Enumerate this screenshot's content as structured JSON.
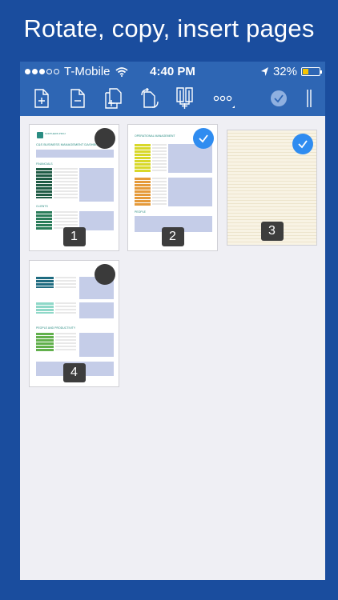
{
  "headline": "Rotate, copy, insert pages",
  "status_bar": {
    "carrier": "T-Mobile",
    "time": "4:40 PM",
    "battery": "32%",
    "signal_bars_filled": 3,
    "signal_bars_total": 5,
    "battery_level": 0.32
  },
  "toolbar": {
    "icons": [
      "insert-page-icon",
      "delete-page-icon",
      "copy-page-icon",
      "rotate-page-icon",
      "extract-pages-icon",
      "more-icon",
      "done-checkmark-icon",
      "sidebar-toggle-icon"
    ]
  },
  "pages": [
    {
      "number": "1",
      "selected": false
    },
    {
      "number": "2",
      "selected": true
    },
    {
      "number": "3",
      "selected": true
    },
    {
      "number": "4",
      "selected": false
    }
  ],
  "page1": {
    "brand": "NORTHERN PROJ",
    "title": "C&S BUSINESS MANAGEMENT DASHBOARD",
    "section_financials": "FINANCIALS",
    "section_clients": "CLIENTS"
  },
  "page2": {
    "section_ops": "OPERATIONAL MANAGEMENT",
    "section_people": "PEOPLE"
  },
  "page4": {
    "section_people": "PEOPLE AND PRODUCTIVITY"
  },
  "colors": {
    "background": "#1a4d9e",
    "bar": "#2e66b4",
    "select_on": "#2f8cf0",
    "teal": "#2a8c82"
  }
}
